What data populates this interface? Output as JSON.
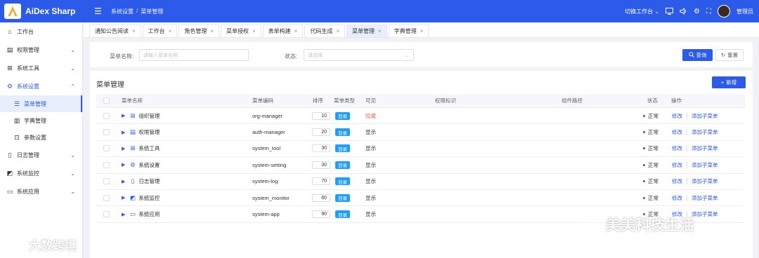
{
  "header": {
    "app_title": "AiDex Sharp",
    "breadcrumb": [
      "系统设置",
      "菜单管理"
    ],
    "switch_workspace": "切换工作台",
    "username": "管理员",
    "accent": "#2c5ae9"
  },
  "sidebar": {
    "items": [
      {
        "label": "工作台",
        "icon": "home-icon"
      },
      {
        "label": "权限管理",
        "icon": "document-icon"
      },
      {
        "label": "系统工具",
        "icon": "grid-icon"
      },
      {
        "label": "系统设置",
        "icon": "gear-icon"
      },
      {
        "label": "日志管理",
        "icon": "file-icon"
      },
      {
        "label": "系统监控",
        "icon": "chart-icon"
      },
      {
        "label": "系统应用",
        "icon": "monitor-icon"
      }
    ],
    "sub_items": [
      {
        "label": "菜单管理",
        "icon": "list-icon"
      },
      {
        "label": "字典管理",
        "icon": "book-icon"
      },
      {
        "label": "参数设置",
        "icon": "terminal-icon"
      }
    ]
  },
  "tabs": [
    "通知公告阅读",
    "工作台",
    "角色管理",
    "菜单授权",
    "表单构建",
    "代码生成",
    "菜单管理",
    "字典管理"
  ],
  "filter": {
    "name_label": "菜单名称:",
    "name_placeholder": "请输入菜单名称",
    "status_label": "状态:",
    "status_placeholder": "请选择",
    "search_button": "查询",
    "reset_button": "重置"
  },
  "panel": {
    "title": "菜单管理",
    "add_button": "新增"
  },
  "table": {
    "columns": [
      "菜单名称",
      "菜单编码",
      "排序",
      "菜单类型",
      "可见",
      "权限标识",
      "组件路径",
      "状态",
      "操作"
    ],
    "rows": [
      {
        "name": "组织管理",
        "icon": "grid-icon",
        "code": "org-manager",
        "sort": "10",
        "type": "目录",
        "visible": "隐藏",
        "status": "正常",
        "edit": "修改",
        "add_child": "添加子菜单"
      },
      {
        "name": "权限管理",
        "icon": "document-icon",
        "code": "auth-manager",
        "sort": "20",
        "type": "目录",
        "visible": "显示",
        "status": "正常",
        "edit": "修改",
        "add_child": "添加子菜单"
      },
      {
        "name": "系统工具",
        "icon": "grid-icon",
        "code": "system_tool",
        "sort": "30",
        "type": "目录",
        "visible": "显示",
        "status": "正常",
        "edit": "修改",
        "add_child": "添加子菜单"
      },
      {
        "name": "系统设置",
        "icon": "gear-icon",
        "code": "system-setting",
        "sort": "30",
        "type": "目录",
        "visible": "显示",
        "status": "正常",
        "edit": "修改",
        "add_child": "添加子菜单"
      },
      {
        "name": "日志管理",
        "icon": "file-icon",
        "code": "system-log",
        "sort": "70",
        "type": "目录",
        "visible": "显示",
        "status": "正常",
        "edit": "修改",
        "add_child": "添加子菜单"
      },
      {
        "name": "系统监控",
        "icon": "chart-icon",
        "code": "system_monitor",
        "sort": "80",
        "type": "目录",
        "visible": "显示",
        "status": "正常",
        "edit": "修改",
        "add_child": "添加子菜单"
      },
      {
        "name": "系统应用",
        "icon": "monitor-icon",
        "code": "system-app",
        "sort": "90",
        "type": "目录",
        "visible": "显示",
        "status": "正常",
        "edit": "修改",
        "add_child": "添加子菜单"
      }
    ]
  },
  "watermarks": {
    "left": "大数跨境",
    "right": "美美科技生活"
  }
}
